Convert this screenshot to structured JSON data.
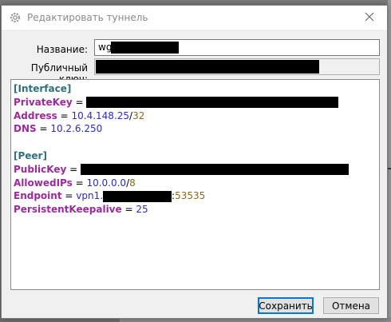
{
  "window": {
    "title": "Редактировать туннель",
    "close_icon": "close-icon",
    "title_icon": "gear-icon"
  },
  "form": {
    "name_label": "Название:",
    "name_value": "wg",
    "public_key_label": "Публичный ключ:"
  },
  "config": {
    "interface_header": "[Interface]",
    "private_key_key": "PrivateKey",
    "address_key": "Address",
    "address_ip": "10.4.148.25",
    "address_mask": "32",
    "dns_key": "DNS",
    "dns_value": "10.2.6.250",
    "peer_header": "[Peer]",
    "public_key_key": "PublicKey",
    "allowed_ips_key": "AllowedIPs",
    "allowed_ips_ip": "10.0.0.0",
    "allowed_ips_mask": "8",
    "endpoint_key": "Endpoint",
    "endpoint_prefix": "vpn1.",
    "endpoint_port": "53535",
    "keepalive_key": "PersistentKeepalive",
    "keepalive_value": "25",
    "equals": " = ",
    "slash": "/",
    "colon": ":"
  },
  "buttons": {
    "save": "Сохранить",
    "cancel": "Отмена"
  }
}
